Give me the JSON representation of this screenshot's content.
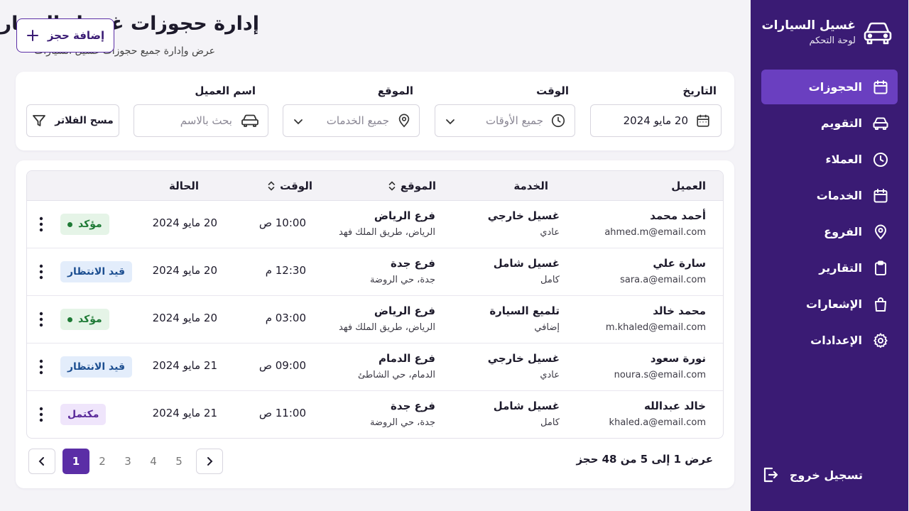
{
  "sidebar": {
    "brand_title": "غسيل السيارات",
    "brand_subtitle": "لوحة التحكم",
    "items": [
      {
        "label": "الحجوزات",
        "icon": "calendar-icon",
        "active": true
      },
      {
        "label": "التقويم",
        "icon": "car-icon"
      },
      {
        "label": "العملاء",
        "icon": "clock-icon"
      },
      {
        "label": "الخدمات",
        "icon": "calendar-icon"
      },
      {
        "label": "الفروع",
        "icon": "location-pin-icon"
      },
      {
        "label": "التقارير",
        "icon": "clipboard-icon"
      },
      {
        "label": "الإشعارات",
        "icon": "shopping-bag-icon"
      },
      {
        "label": "الإعدادات",
        "icon": "gear-icon"
      }
    ],
    "logout_label": "تسجيل خروج"
  },
  "header": {
    "title": "إدارة حجوزات غسيل السيارات",
    "subtitle": "عرض وإدارة جميع حجوزات غسيل السيارات",
    "add_button": "إضافة حجز"
  },
  "filters": {
    "date_label": "التاريخ",
    "date_value": "20 مايو 2024",
    "time_label": "الوقت",
    "time_placeholder": "جميع الأوقات",
    "location_label": "الموقع",
    "location_placeholder": "جميع الخدمات",
    "customer_label": "اسم العميل",
    "customer_placeholder": "بحث بالاسم",
    "clear_button": "مسح الفلاتر"
  },
  "table": {
    "headers": {
      "customer": "العميل",
      "service": "الخدمة",
      "location": "الموقع",
      "time": "الوقت",
      "status": "الحالة"
    },
    "rows": [
      {
        "name": "أحمد محمد",
        "email": "ahmed.m@email.com",
        "service": "غسيل خارجي",
        "service_type": "عادي",
        "branch": "فرع الرياض",
        "address": "الرياض، طريق الملك فهد",
        "time": "10:00 ص",
        "date": "20 مايو 2024",
        "status": "مؤكد",
        "status_key": "confirmed"
      },
      {
        "name": "سارة علي",
        "email": "sara.a@email.com",
        "service": "غسيل شامل",
        "service_type": "كامل",
        "branch": "فرع جدة",
        "address": "جدة، حي الروضة",
        "time": "12:30 م",
        "date": "20 مايو 2024",
        "status": "قيد الانتظار",
        "status_key": "pending"
      },
      {
        "name": "محمد خالد",
        "email": "m.khaled@email.com",
        "service": "تلميع السيارة",
        "service_type": "إضافي",
        "branch": "فرع الرياض",
        "address": "الرياض، طريق الملك فهد",
        "time": "03:00 م",
        "date": "20 مايو 2024",
        "status": "مؤكد",
        "status_key": "confirmed"
      },
      {
        "name": "نورة سعود",
        "email": "noura.s@email.com",
        "service": "غسيل خارجي",
        "service_type": "عادي",
        "branch": "فرع الدمام",
        "address": "الدمام، حي الشاطئ",
        "time": "09:00 ص",
        "date": "21 مايو 2024",
        "status": "قيد الانتظار",
        "status_key": "pending"
      },
      {
        "name": "خالد عبدالله",
        "email": "khaled.a@email.com",
        "service": "غسيل شامل",
        "service_type": "كامل",
        "branch": "فرع جدة",
        "address": "جدة، حي الروضة",
        "time": "11:00 ص",
        "date": "21 مايو 2024",
        "status": "مكتمل",
        "status_key": "completed"
      }
    ]
  },
  "pagination": {
    "summary": "عرض 1 إلى 5 من 48 حجز",
    "pages": [
      "1",
      "2",
      "3",
      "4",
      "5"
    ],
    "current": "1"
  },
  "colors": {
    "sidebar_bg": "#3a1b74",
    "active_item": "#6a3fc0",
    "accent": "#5b2ea6",
    "confirmed_bg": "#e5f4e7",
    "confirmed_fg": "#1e7a35",
    "pending_bg": "#e3edfb",
    "pending_fg": "#1d4f91",
    "completed_bg": "#efe5fb",
    "completed_fg": "#5a2a9a"
  }
}
